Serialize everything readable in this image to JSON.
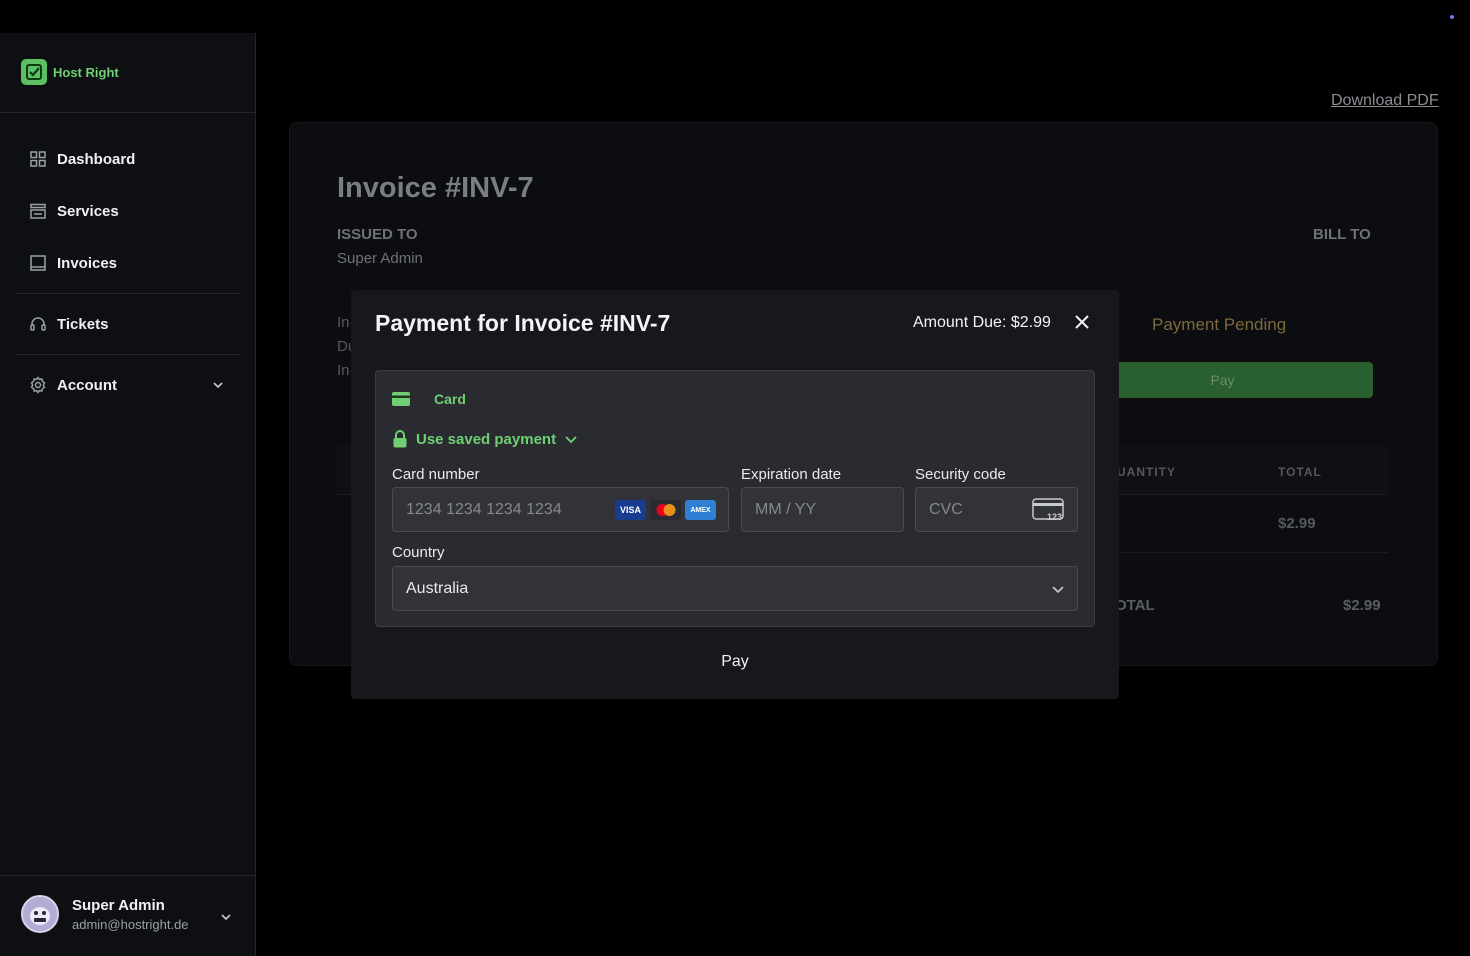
{
  "app": {
    "name": "Host Right"
  },
  "sidebar": {
    "items": [
      {
        "label": "Dashboard",
        "icon": "grid-icon"
      },
      {
        "label": "Services",
        "icon": "server-icon"
      },
      {
        "label": "Invoices",
        "icon": "invoice-icon"
      },
      {
        "label": "Tickets",
        "icon": "headset-icon"
      },
      {
        "label": "Account",
        "icon": "gear-icon"
      }
    ],
    "user": {
      "name": "Super Admin",
      "email": "admin@hostright.de"
    }
  },
  "invoice": {
    "download_label": "Download PDF",
    "title": "Invoice #INV-7",
    "issued_to_label": "ISSUED TO",
    "issued_to_name": "Super Admin",
    "bill_to_label": "BILL TO",
    "partial_lines": [
      "In",
      "Du",
      "In"
    ],
    "status": "Payment Pending",
    "pay_label": "Pay",
    "table": {
      "headers": [
        "UANTITY",
        "TOTAL"
      ],
      "row_total": "$2.99",
      "total_label": "OTAL",
      "total_value": "$2.99"
    }
  },
  "modal": {
    "title": "Payment for Invoice #INV-7",
    "amount_due": "Amount Due: $2.99",
    "tab_label": "Card",
    "saved_payment_label": "Use saved payment",
    "card_number_label": "Card number",
    "card_number_placeholder": "1234 1234 1234 1234",
    "brands": [
      "VISA",
      "",
      "AMEX"
    ],
    "expiry_label": "Expiration date",
    "expiry_placeholder": "MM / YY",
    "cvc_label": "Security code",
    "cvc_placeholder": "CVC",
    "cvc_icon_text": "123",
    "country_label": "Country",
    "country_value": "Australia",
    "pay_label": "Pay"
  },
  "colors": {
    "accent": "#6fcf72",
    "pending": "#7c6a3d",
    "pay_button": "#2a5f2f"
  }
}
